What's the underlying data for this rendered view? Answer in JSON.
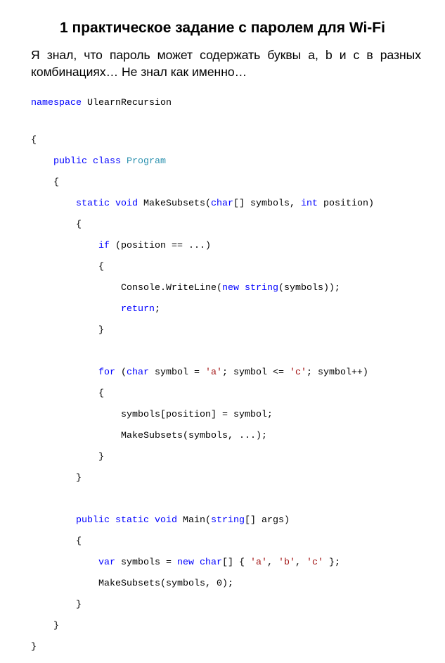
{
  "title": "1 практическое задание с паролем для Wi-Fi",
  "description": "Я знал, что пароль может содержать буквы a, b и c в разных комбинациях… Не знал как именно…",
  "code": {
    "keywords": {
      "namespace": "namespace",
      "public": "public",
      "class": "class",
      "static": "static",
      "void": "void",
      "char": "char",
      "int": "int",
      "if": "if",
      "new": "new",
      "string": "string",
      "return": "return",
      "for": "for",
      "var": "var"
    },
    "namespace_name": "UlearnRecursion",
    "class_name": "Program",
    "open_brace": "{",
    "close_brace": "}",
    "make_subsets": {
      "sig_name": "MakeSubsets(",
      "sig_mid": "[] symbols, ",
      "sig_end": " position)",
      "if_cond": " (position == ...)",
      "console_call": "Console.WriteLine(",
      "console_args": "(symbols));",
      "return_end": ";",
      "for_open": " (",
      "for_var": " symbol = ",
      "for_cmp": "; symbol <= ",
      "for_end": "; symbol++)",
      "lit_a": "'a'",
      "lit_c": "'c'",
      "assign": "symbols[position] = symbol;",
      "recurse": "MakeSubsets(symbols, ...);"
    },
    "main": {
      "sig_name": "Main(",
      "sig_end": "[] args)",
      "var_decl": " symbols = ",
      "arr_open": "[] { ",
      "lit_a": "'a'",
      "lit_b": "'b'",
      "lit_c": "'c'",
      "sep": ", ",
      "arr_close": " };",
      "call": "MakeSubsets(symbols, 0);"
    }
  }
}
